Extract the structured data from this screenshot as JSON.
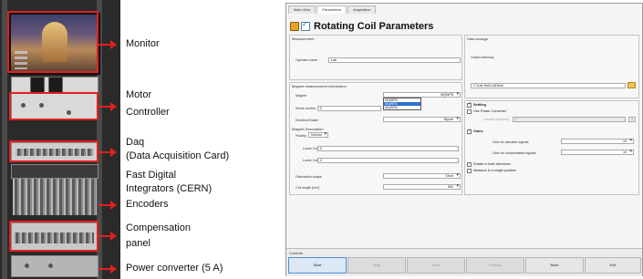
{
  "annotations": {
    "monitor": "Monitor",
    "motor_controller_line1": "Motor",
    "motor_controller_line2": "Controller",
    "daq_line1": "Daq",
    "daq_line2": "(Data Acquisition Card)",
    "fdi_line1": "Fast Digital",
    "fdi_line2": "Integrators (CERN)",
    "encoders": "Encoders",
    "compensation_line1": "Compensation",
    "compensation_line2": "panel",
    "power_converter": "Power converter (5 A)"
  },
  "app": {
    "tabs": [
      "Main View",
      "Parameters",
      "Acquisition"
    ],
    "active_tab": 1,
    "title": "Rotating Coil Parameters",
    "measurement": {
      "section": "Measurement",
      "operator_label": "Operator name",
      "operator_value": "Lab"
    },
    "magnet": {
      "section": "Magnet measurement information",
      "magnet_label": "Magnet",
      "magnet_value": "MQWFB",
      "magnet_options": [
        "MQWFB",
        "MQWFA",
        "MQWFB"
      ],
      "serial_label": "Serial number",
      "serial_value": "0",
      "orientation_label": "Direction/Scaler",
      "orientation_value": "Dipole"
    },
    "magnet_description": {
      "section": "Magnet Description",
      "polarity_label": "Polarity",
      "polarity_value": "Normal",
      "lower_coil_label": "Lower Coil",
      "lower_coil_value": "0",
      "upper_coil_label": "Lower Coil",
      "upper_coil_value": "0",
      "fabrication_label": "Fabrication shape",
      "fabrication_value": "Short",
      "coil_length_label": "Coil length [mm]",
      "coil_length_value": "600"
    },
    "data_storage": {
      "section": "Data storage",
      "output_dir_label": "Output directory",
      "output_dir_value": "C:\\Lab Rot\\Coil\\Test\\"
    },
    "settings": {
      "settling_label": "Settling",
      "settling_checked": true,
      "use_power_conv_label": "Use Power Converter",
      "use_power_conv_checked": false,
      "current_label": "Current (Ampere)",
      "current_value": "0",
      "gains_label": "Gains",
      "gains_checked": true,
      "gain_abs_label": "Gain for absolute signals",
      "gain_abs_value": "10",
      "gain_comp_label": "Gain for compensated signals",
      "gain_comp_value": "10",
      "rotate_both_label": "Rotate in both directions",
      "rotate_both_checked": false,
      "measure_single_label": "Measure in a single position",
      "measure_single_checked": false
    },
    "controls": {
      "label": "Controls",
      "buttons": [
        "Start",
        "Stop",
        "Abort",
        "Prepare",
        "Back",
        "Exit"
      ]
    }
  }
}
